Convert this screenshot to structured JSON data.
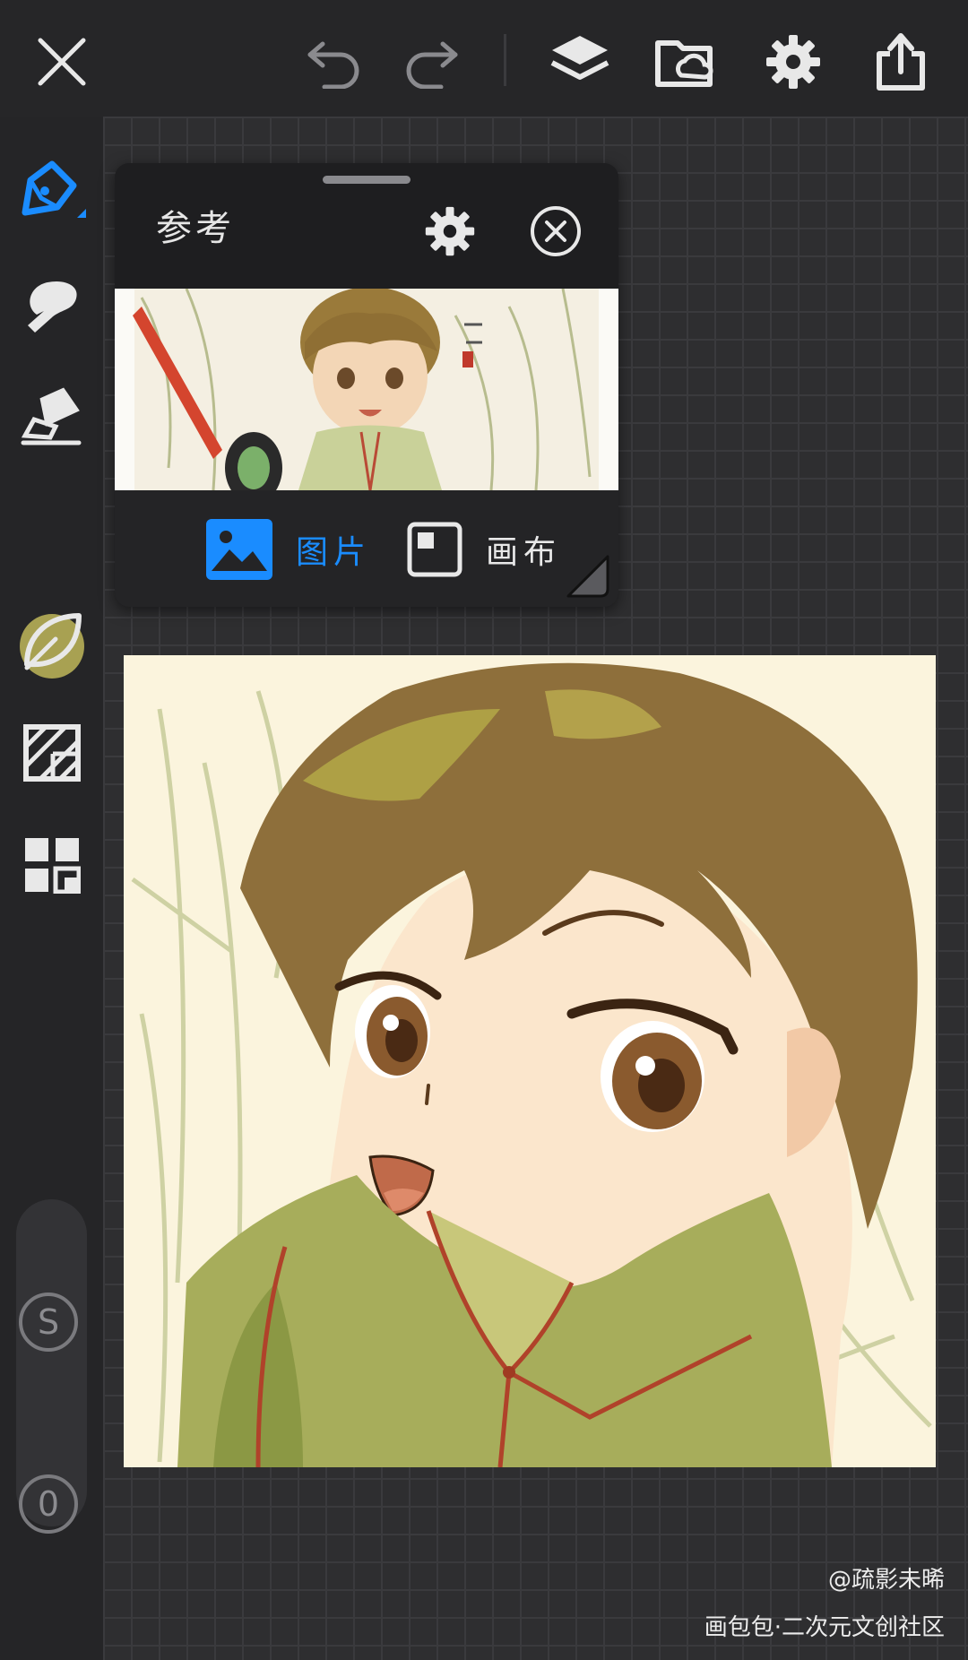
{
  "toolbar": {
    "icons": [
      "close-icon",
      "undo-icon",
      "redo-icon",
      "layers-icon",
      "cloud-folder-icon",
      "gear-icon",
      "share-icon"
    ]
  },
  "sidebar": {
    "icons": [
      "pen-icon",
      "brush-icon",
      "eraser-icon",
      "color-swatch",
      "leaf-icon",
      "texture-icon",
      "grid-icon"
    ],
    "current_color": "#a8a152",
    "size_badge": "S",
    "opacity_badge": "0"
  },
  "reference_panel": {
    "title": "参考",
    "tabs": [
      {
        "label": "图片",
        "active": true
      },
      {
        "label": "画布",
        "active": false
      }
    ]
  },
  "watermark": {
    "author": "@疏影未晞",
    "site": "画包包·二次元文创社区"
  },
  "colors": {
    "accent": "#1a8cff",
    "background": "#2c2c2e"
  }
}
